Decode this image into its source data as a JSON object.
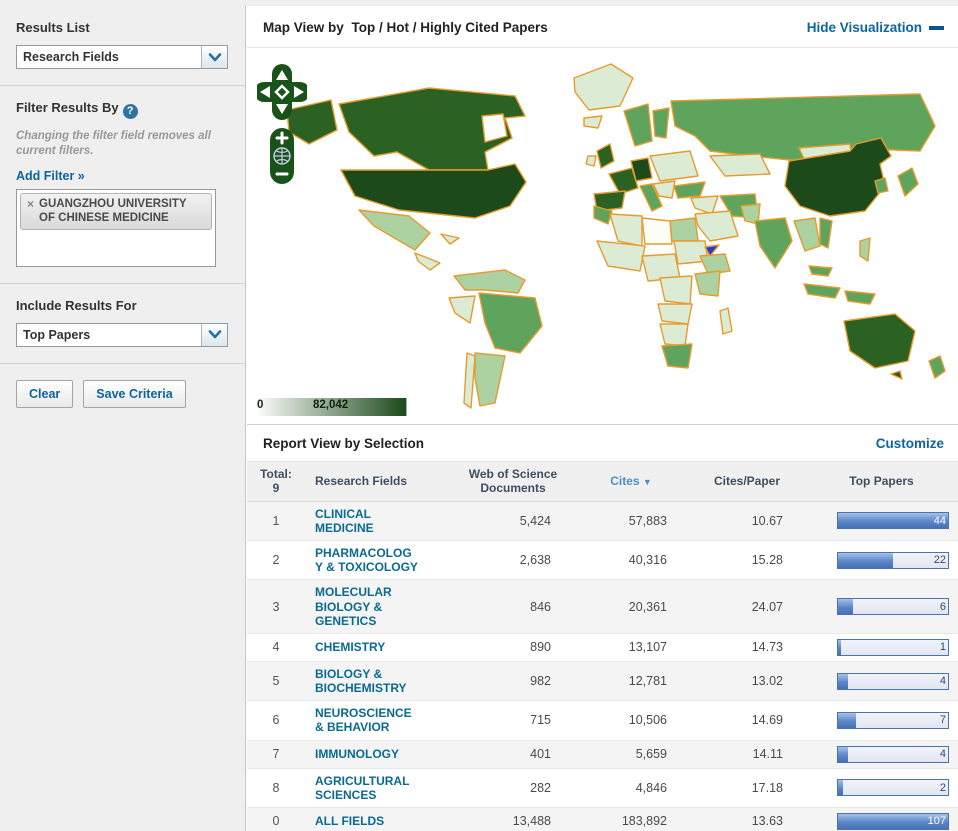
{
  "theme": {
    "accent_blue": "#0e649c",
    "field_link_teal": "#0a6a8f",
    "bar_fill_blue": "#5b86c9",
    "map_orange_border": "#e69b2e",
    "map_green_darkest": "#1c4a1a",
    "selected_marker_blue": "#2637d4"
  },
  "sidebar": {
    "results_list": {
      "label": "Results List",
      "selected": "Research Fields"
    },
    "filter": {
      "label": "Filter Results By",
      "help_icon": "question-icon",
      "note": "Changing the filter field removes all current filters.",
      "add_filter": "Add Filter »",
      "tags": [
        {
          "remove": "×",
          "text": "GUANGZHOU UNIVERSITY OF CHINESE MEDICINE"
        }
      ]
    },
    "include": {
      "label": "Include Results For",
      "selected": "Top Papers"
    },
    "buttons": {
      "clear": "Clear",
      "save": "Save Criteria"
    }
  },
  "map": {
    "title_prefix": "Map View by",
    "title": "Top / Hot / Highly Cited Papers",
    "hide_link": "Hide Visualization",
    "legend": {
      "min": "0",
      "max": "82,042"
    },
    "palette": {
      "g0": "#fbfdf6",
      "g1": "#dcecd4",
      "g2": "#abd2a0",
      "g3": "#5fa45c",
      "g4": "#2b6123",
      "g5": "#1c4a1a"
    }
  },
  "report": {
    "title": "Report View by Selection",
    "customize": "Customize",
    "table": {
      "headers": {
        "total_label": "Total:",
        "total_count": "9",
        "fields": "Research Fields",
        "docs": "Web of Science Documents",
        "cites": "Cites",
        "sort_arrow": "▼",
        "cites_paper": "Cites/Paper",
        "top_papers": "Top Papers"
      },
      "rows": [
        {
          "rank": "1",
          "field": "CLINICAL MEDICINE",
          "docs": "5,424",
          "cites": "57,883",
          "cites_paper": "10.67",
          "top_papers": 44
        },
        {
          "rank": "2",
          "field": "PHARMACOLOGY & TOXICOLOGY",
          "docs": "2,638",
          "cites": "40,316",
          "cites_paper": "15.28",
          "top_papers": 22
        },
        {
          "rank": "3",
          "field": "MOLECULAR BIOLOGY & GENETICS",
          "docs": "846",
          "cites": "20,361",
          "cites_paper": "24.07",
          "top_papers": 6
        },
        {
          "rank": "4",
          "field": "CHEMISTRY",
          "docs": "890",
          "cites": "13,107",
          "cites_paper": "14.73",
          "top_papers": 1
        },
        {
          "rank": "5",
          "field": "BIOLOGY & BIOCHEMISTRY",
          "docs": "982",
          "cites": "12,781",
          "cites_paper": "13.02",
          "top_papers": 4
        },
        {
          "rank": "6",
          "field": "NEUROSCIENCE & BEHAVIOR",
          "docs": "715",
          "cites": "10,506",
          "cites_paper": "14.69",
          "top_papers": 7
        },
        {
          "rank": "7",
          "field": "IMMUNOLOGY",
          "docs": "401",
          "cites": "5,659",
          "cites_paper": "14.11",
          "top_papers": 4
        },
        {
          "rank": "8",
          "field": "AGRICULTURAL SCIENCES",
          "docs": "282",
          "cites": "4,846",
          "cites_paper": "17.18",
          "top_papers": 2
        },
        {
          "rank": "0",
          "field": "ALL FIELDS",
          "docs": "13,488",
          "cites": "183,892",
          "cites_paper": "13.63",
          "top_papers": 107
        }
      ]
    }
  }
}
